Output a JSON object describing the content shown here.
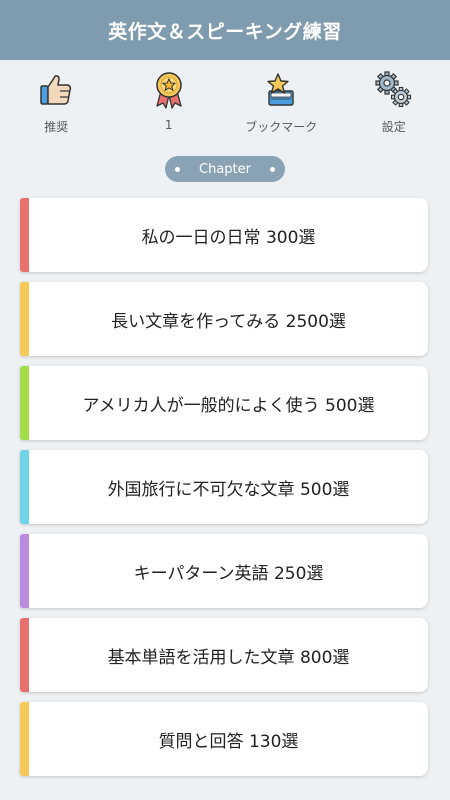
{
  "header": {
    "title": "英作文＆スピーキング練習"
  },
  "toolbar": {
    "items": [
      {
        "label": "推奨",
        "icon": "thumbs-up-icon"
      },
      {
        "label": "1",
        "icon": "medal-icon"
      },
      {
        "label": "ブックマーク",
        "icon": "bookmark-star-icon"
      },
      {
        "label": "設定",
        "icon": "gears-icon"
      }
    ]
  },
  "section": {
    "label": "Chapter"
  },
  "chapters": [
    {
      "label": "私の一日の日常 300選",
      "color": "#e8706d"
    },
    {
      "label": "長い文章を作ってみる 2500選",
      "color": "#f7c85a"
    },
    {
      "label": "アメリカ人が一般的によく使う 500選",
      "color": "#a4dd4a"
    },
    {
      "label": "外国旅行に不可欠な文章 500選",
      "color": "#6fd3ea"
    },
    {
      "label": "キーパターン英語 250選",
      "color": "#b98be0"
    },
    {
      "label": "基本単語を活用した文章 800選",
      "color": "#e8706d"
    },
    {
      "label": "質問と回答 130選",
      "color": "#f7c85a"
    }
  ]
}
